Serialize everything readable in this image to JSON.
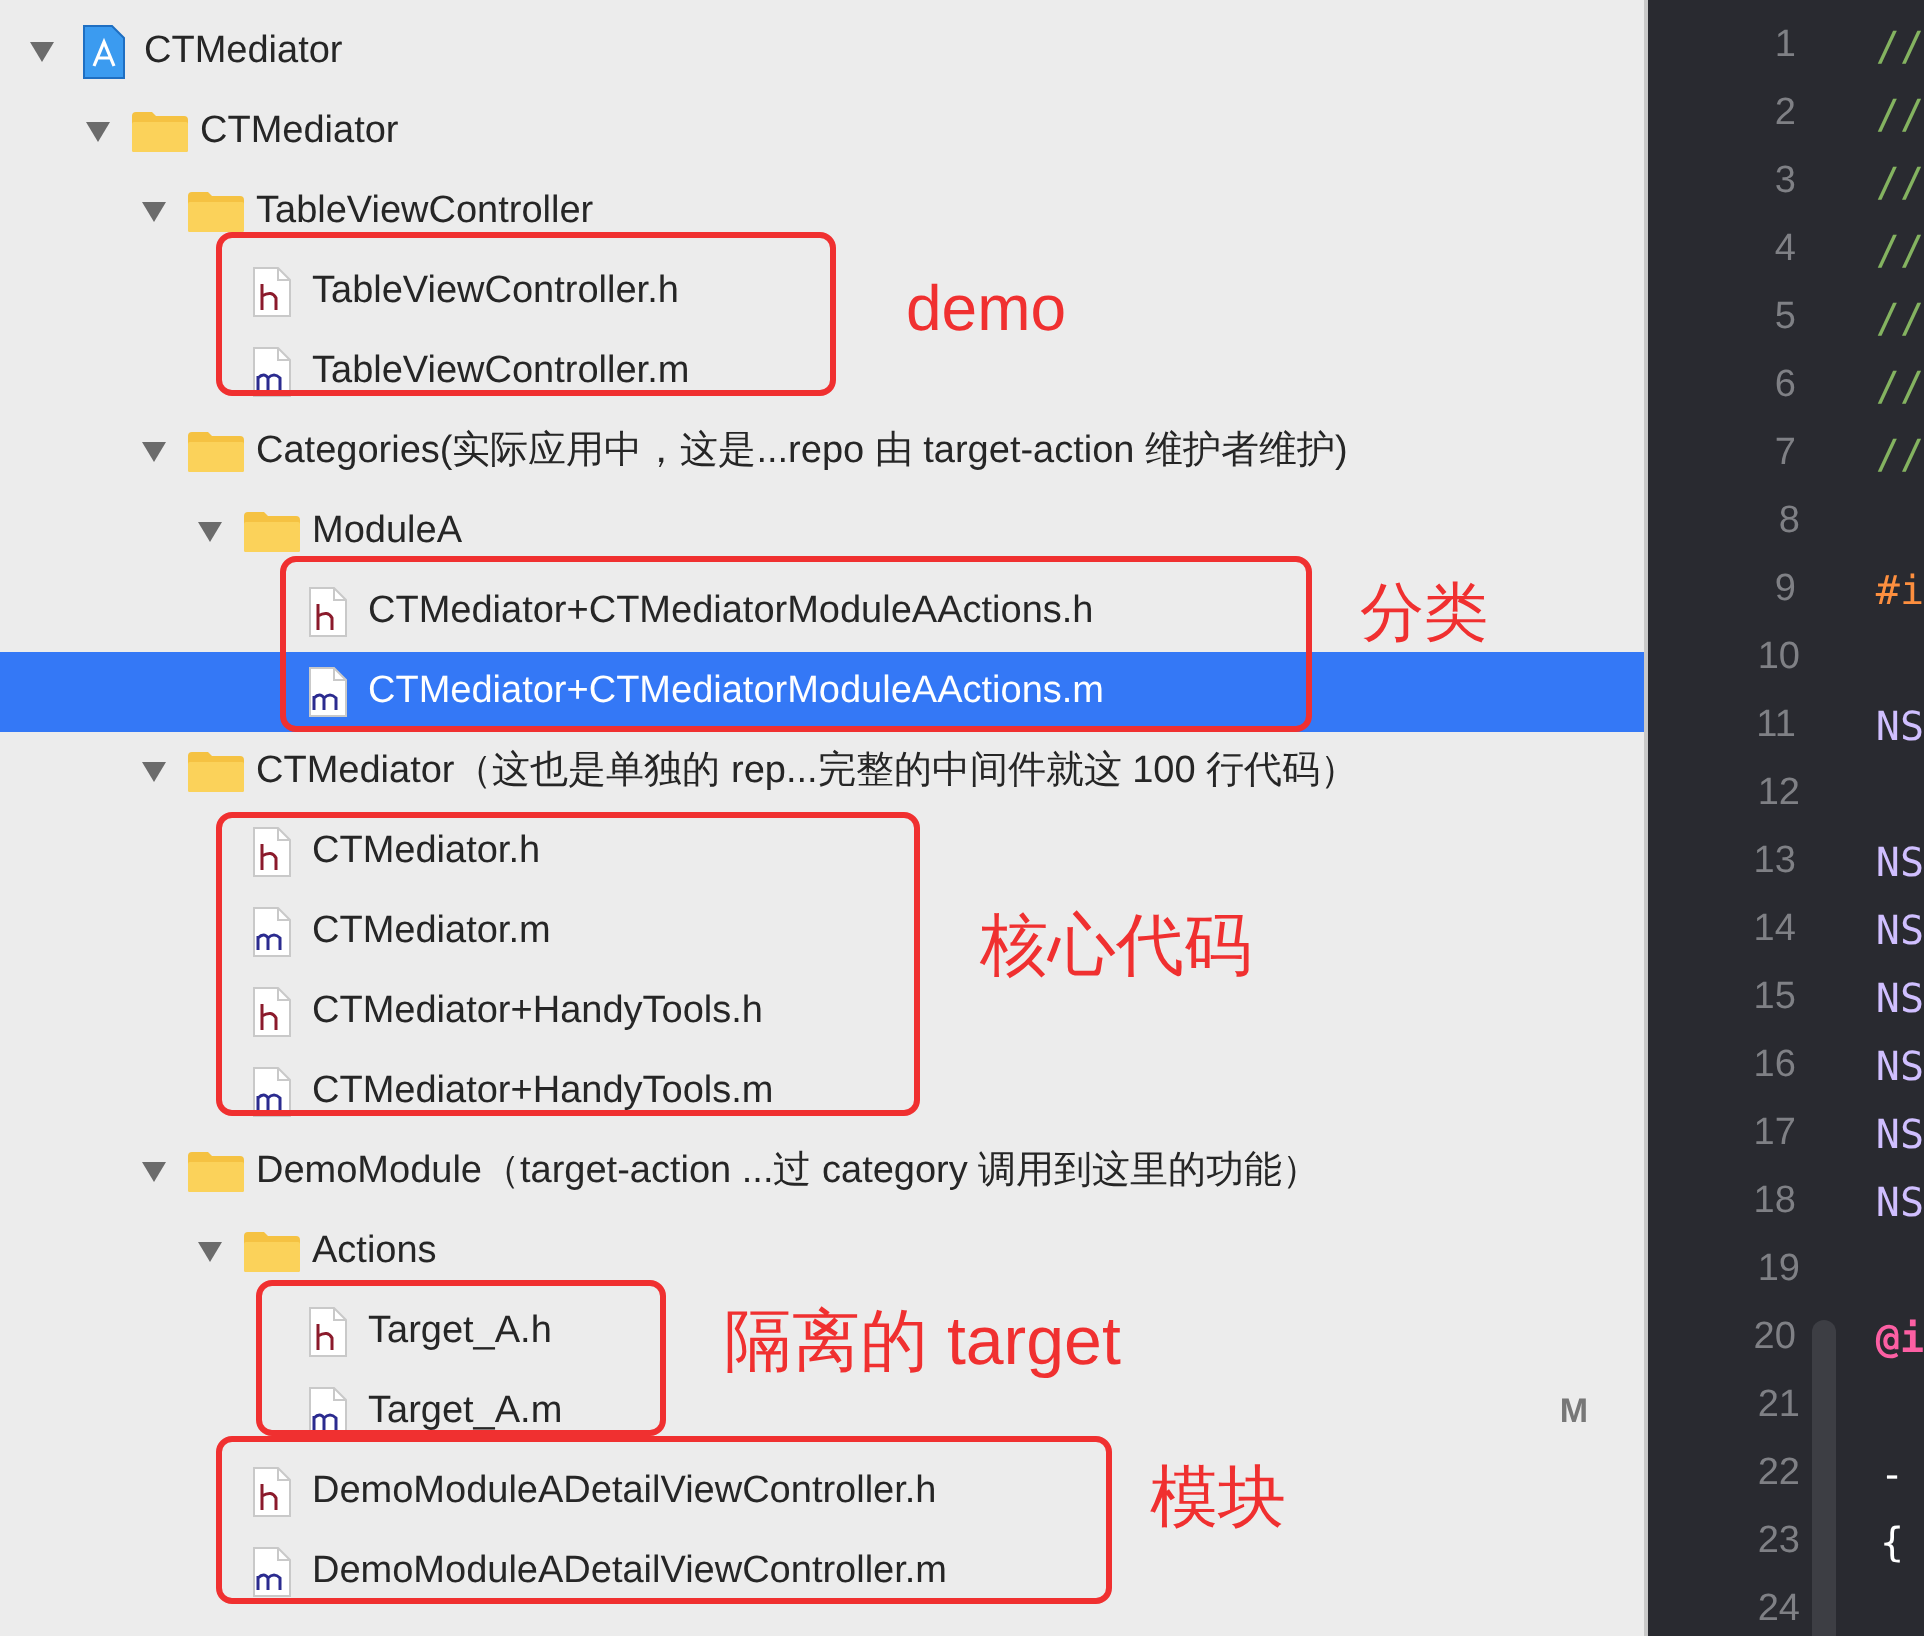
{
  "navigator": {
    "tree": [
      {
        "kind": "project",
        "label": "CTMediator",
        "expanded": true,
        "children": [
          {
            "kind": "folder",
            "label": "CTMediator",
            "expanded": true,
            "children": [
              {
                "kind": "folder",
                "label": "TableViewController",
                "expanded": true,
                "children": [
                  {
                    "kind": "h",
                    "label": "TableViewController.h",
                    "selected": false
                  },
                  {
                    "kind": "m",
                    "label": "TableViewController.m",
                    "selected": false
                  }
                ]
              },
              {
                "kind": "folder",
                "label": "Categories(实际应用中，这是...repo 由 target-action 维护者维护)",
                "expanded": true,
                "children": [
                  {
                    "kind": "folder",
                    "label": "ModuleA",
                    "expanded": true,
                    "children": [
                      {
                        "kind": "h",
                        "label": "CTMediator+CTMediatorModuleAActions.h",
                        "selected": false
                      },
                      {
                        "kind": "m",
                        "label": "CTMediator+CTMediatorModuleAActions.m",
                        "selected": true
                      }
                    ]
                  }
                ]
              },
              {
                "kind": "folder",
                "label": "CTMediator（这也是单独的 rep...完整的中间件就这 100 行代码）",
                "expanded": true,
                "children": [
                  {
                    "kind": "h",
                    "label": "CTMediator.h",
                    "selected": false
                  },
                  {
                    "kind": "m",
                    "label": "CTMediator.m",
                    "selected": false
                  },
                  {
                    "kind": "h",
                    "label": "CTMediator+HandyTools.h",
                    "selected": false
                  },
                  {
                    "kind": "m",
                    "label": "CTMediator+HandyTools.m",
                    "selected": false
                  }
                ]
              },
              {
                "kind": "folder",
                "label": "DemoModule（target-action ...过 category 调用到这里的功能）",
                "expanded": true,
                "children": [
                  {
                    "kind": "folder",
                    "label": "Actions",
                    "expanded": true,
                    "children": [
                      {
                        "kind": "h",
                        "label": "Target_A.h",
                        "selected": false
                      },
                      {
                        "kind": "m",
                        "label": "Target_A.m",
                        "selected": false,
                        "status": "M"
                      }
                    ]
                  },
                  {
                    "kind": "h",
                    "label": "DemoModuleADetailViewController.h",
                    "selected": false
                  },
                  {
                    "kind": "m",
                    "label": "DemoModuleADetailViewController.m",
                    "selected": false
                  }
                ]
              }
            ]
          }
        ]
      }
    ]
  },
  "annotations": [
    {
      "label": "demo"
    },
    {
      "label": "分类"
    },
    {
      "label": "核心代码"
    },
    {
      "label": "隔离的 target"
    },
    {
      "label": "模块"
    }
  ],
  "editor": {
    "lines": [
      {
        "number": "1",
        "text": "//",
        "kind": "comment"
      },
      {
        "number": "2",
        "text": "//",
        "kind": "comment"
      },
      {
        "number": "3",
        "text": "//",
        "kind": "comment"
      },
      {
        "number": "4",
        "text": "//",
        "kind": "comment"
      },
      {
        "number": "5",
        "text": "//",
        "kind": "comment"
      },
      {
        "number": "6",
        "text": "//",
        "kind": "comment"
      },
      {
        "number": "7",
        "text": "//",
        "kind": "comment"
      },
      {
        "number": "8"
      },
      {
        "number": "9",
        "text": "#i",
        "kind": "preprocessor"
      },
      {
        "number": "10"
      },
      {
        "number": "11",
        "text": "NS",
        "kind": "type"
      },
      {
        "number": "12"
      },
      {
        "number": "13",
        "text": "NS",
        "kind": "type"
      },
      {
        "number": "14",
        "text": "NS",
        "kind": "type"
      },
      {
        "number": "15",
        "text": "NS",
        "kind": "type"
      },
      {
        "number": "16",
        "text": "NS",
        "kind": "type"
      },
      {
        "number": "17",
        "text": "NS",
        "kind": "type"
      },
      {
        "number": "18",
        "text": "NS",
        "kind": "type"
      },
      {
        "number": "19"
      },
      {
        "number": "20",
        "text": "@i",
        "kind": "keyword"
      },
      {
        "number": "21"
      },
      {
        "number": "22",
        "text": "-",
        "kind": "plain"
      },
      {
        "number": "23",
        "text": "{",
        "kind": "plain"
      },
      {
        "number": "24"
      }
    ]
  }
}
